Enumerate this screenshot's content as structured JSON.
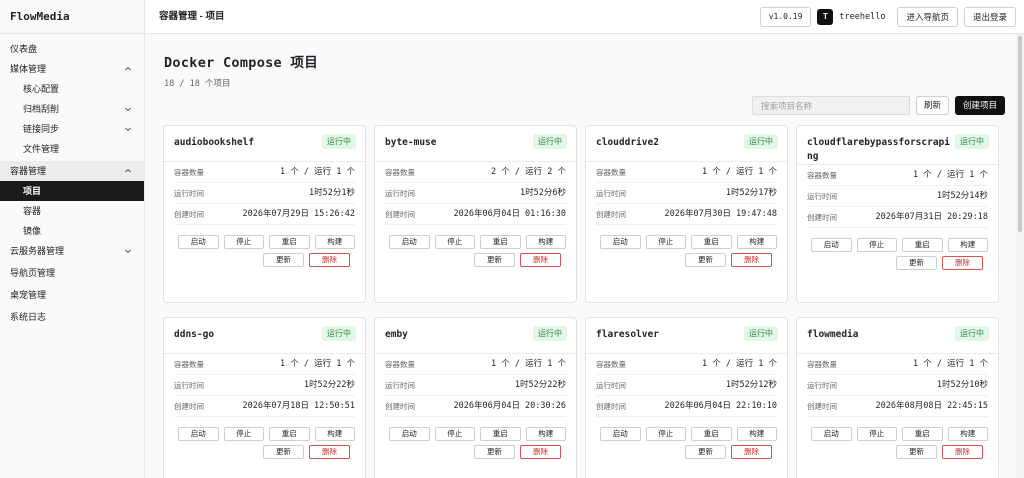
{
  "app": {
    "brand": "FlowMedia"
  },
  "sidebar": {
    "items": [
      {
        "label": "仪表盘"
      },
      {
        "label": "媒体管理"
      },
      {
        "label": "核心配置"
      },
      {
        "label": "归档刮削"
      },
      {
        "label": "链接同步"
      },
      {
        "label": "文件管理"
      },
      {
        "label": "容器管理"
      },
      {
        "label": "项目"
      },
      {
        "label": "容器"
      },
      {
        "label": "镜像"
      },
      {
        "label": "云服务器管理"
      },
      {
        "label": "导航页管理"
      },
      {
        "label": "桌宠管理"
      },
      {
        "label": "系统日志"
      }
    ]
  },
  "header": {
    "breadcrumb": "容器管理 - 项目",
    "version": "v1.0.19",
    "avatar_letter": "T",
    "username": "treehello",
    "nav_button": "进入导航页",
    "logout_button": "退出登录"
  },
  "page": {
    "title": "Docker Compose 项目",
    "count": "18 / 18 个项目",
    "search_placeholder": "搜索项目名称",
    "refresh_button": "刷新",
    "create_button": "创建项目"
  },
  "card_labels": {
    "count": "容器数量",
    "uptime": "运行时间",
    "created": "创建时间",
    "start": "启动",
    "stop": "停止",
    "restart": "重启",
    "build": "构建",
    "update": "更新",
    "delete": "删除"
  },
  "projects": [
    {
      "name": "audiobookshelf",
      "status": "运行中",
      "count": "1 个 / 运行 1 个",
      "uptime": "1时52分1秒",
      "created": "2026年07月29日 15:26:42"
    },
    {
      "name": "byte-muse",
      "status": "运行中",
      "count": "2 个 / 运行 2 个",
      "uptime": "1时52分6秒",
      "created": "2026年06月04日 01:16:30"
    },
    {
      "name": "clouddrive2",
      "status": "运行中",
      "count": "1 个 / 运行 1 个",
      "uptime": "1时52分17秒",
      "created": "2026年07月30日 19:47:48"
    },
    {
      "name": "cloudflarebypassforscraping",
      "status": "运行中",
      "count": "1 个 / 运行 1 个",
      "uptime": "1时52分14秒",
      "created": "2026年07月31日 20:29:18"
    },
    {
      "name": "ddns-go",
      "status": "运行中",
      "count": "1 个 / 运行 1 个",
      "uptime": "1时52分22秒",
      "created": "2026年07月18日 12:50:51"
    },
    {
      "name": "emby",
      "status": "运行中",
      "count": "1 个 / 运行 1 个",
      "uptime": "1时52分22秒",
      "created": "2026年06月04日 20:30:26"
    },
    {
      "name": "flaresolver",
      "status": "运行中",
      "count": "1 个 / 运行 1 个",
      "uptime": "1时52分12秒",
      "created": "2026年06月04日 22:10:10"
    },
    {
      "name": "flowmedia",
      "status": "运行中",
      "count": "1 个 / 运行 1 个",
      "uptime": "1时52分10秒",
      "created": "2026年08月08日 22:45:15"
    }
  ]
}
